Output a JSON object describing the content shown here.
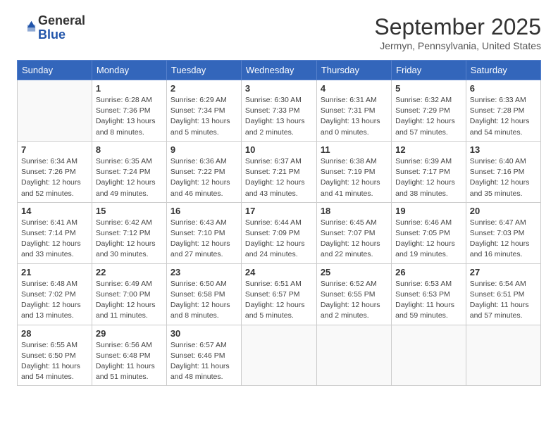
{
  "logo": {
    "general": "General",
    "blue": "Blue"
  },
  "header": {
    "month": "September 2025",
    "location": "Jermyn, Pennsylvania, United States"
  },
  "weekdays": [
    "Sunday",
    "Monday",
    "Tuesday",
    "Wednesday",
    "Thursday",
    "Friday",
    "Saturday"
  ],
  "weeks": [
    [
      {
        "day": "",
        "info": ""
      },
      {
        "day": "1",
        "info": "Sunrise: 6:28 AM\nSunset: 7:36 PM\nDaylight: 13 hours\nand 8 minutes."
      },
      {
        "day": "2",
        "info": "Sunrise: 6:29 AM\nSunset: 7:34 PM\nDaylight: 13 hours\nand 5 minutes."
      },
      {
        "day": "3",
        "info": "Sunrise: 6:30 AM\nSunset: 7:33 PM\nDaylight: 13 hours\nand 2 minutes."
      },
      {
        "day": "4",
        "info": "Sunrise: 6:31 AM\nSunset: 7:31 PM\nDaylight: 13 hours\nand 0 minutes."
      },
      {
        "day": "5",
        "info": "Sunrise: 6:32 AM\nSunset: 7:29 PM\nDaylight: 12 hours\nand 57 minutes."
      },
      {
        "day": "6",
        "info": "Sunrise: 6:33 AM\nSunset: 7:28 PM\nDaylight: 12 hours\nand 54 minutes."
      }
    ],
    [
      {
        "day": "7",
        "info": "Sunrise: 6:34 AM\nSunset: 7:26 PM\nDaylight: 12 hours\nand 52 minutes."
      },
      {
        "day": "8",
        "info": "Sunrise: 6:35 AM\nSunset: 7:24 PM\nDaylight: 12 hours\nand 49 minutes."
      },
      {
        "day": "9",
        "info": "Sunrise: 6:36 AM\nSunset: 7:22 PM\nDaylight: 12 hours\nand 46 minutes."
      },
      {
        "day": "10",
        "info": "Sunrise: 6:37 AM\nSunset: 7:21 PM\nDaylight: 12 hours\nand 43 minutes."
      },
      {
        "day": "11",
        "info": "Sunrise: 6:38 AM\nSunset: 7:19 PM\nDaylight: 12 hours\nand 41 minutes."
      },
      {
        "day": "12",
        "info": "Sunrise: 6:39 AM\nSunset: 7:17 PM\nDaylight: 12 hours\nand 38 minutes."
      },
      {
        "day": "13",
        "info": "Sunrise: 6:40 AM\nSunset: 7:16 PM\nDaylight: 12 hours\nand 35 minutes."
      }
    ],
    [
      {
        "day": "14",
        "info": "Sunrise: 6:41 AM\nSunset: 7:14 PM\nDaylight: 12 hours\nand 33 minutes."
      },
      {
        "day": "15",
        "info": "Sunrise: 6:42 AM\nSunset: 7:12 PM\nDaylight: 12 hours\nand 30 minutes."
      },
      {
        "day": "16",
        "info": "Sunrise: 6:43 AM\nSunset: 7:10 PM\nDaylight: 12 hours\nand 27 minutes."
      },
      {
        "day": "17",
        "info": "Sunrise: 6:44 AM\nSunset: 7:09 PM\nDaylight: 12 hours\nand 24 minutes."
      },
      {
        "day": "18",
        "info": "Sunrise: 6:45 AM\nSunset: 7:07 PM\nDaylight: 12 hours\nand 22 minutes."
      },
      {
        "day": "19",
        "info": "Sunrise: 6:46 AM\nSunset: 7:05 PM\nDaylight: 12 hours\nand 19 minutes."
      },
      {
        "day": "20",
        "info": "Sunrise: 6:47 AM\nSunset: 7:03 PM\nDaylight: 12 hours\nand 16 minutes."
      }
    ],
    [
      {
        "day": "21",
        "info": "Sunrise: 6:48 AM\nSunset: 7:02 PM\nDaylight: 12 hours\nand 13 minutes."
      },
      {
        "day": "22",
        "info": "Sunrise: 6:49 AM\nSunset: 7:00 PM\nDaylight: 12 hours\nand 11 minutes."
      },
      {
        "day": "23",
        "info": "Sunrise: 6:50 AM\nSunset: 6:58 PM\nDaylight: 12 hours\nand 8 minutes."
      },
      {
        "day": "24",
        "info": "Sunrise: 6:51 AM\nSunset: 6:57 PM\nDaylight: 12 hours\nand 5 minutes."
      },
      {
        "day": "25",
        "info": "Sunrise: 6:52 AM\nSunset: 6:55 PM\nDaylight: 12 hours\nand 2 minutes."
      },
      {
        "day": "26",
        "info": "Sunrise: 6:53 AM\nSunset: 6:53 PM\nDaylight: 11 hours\nand 59 minutes."
      },
      {
        "day": "27",
        "info": "Sunrise: 6:54 AM\nSunset: 6:51 PM\nDaylight: 11 hours\nand 57 minutes."
      }
    ],
    [
      {
        "day": "28",
        "info": "Sunrise: 6:55 AM\nSunset: 6:50 PM\nDaylight: 11 hours\nand 54 minutes."
      },
      {
        "day": "29",
        "info": "Sunrise: 6:56 AM\nSunset: 6:48 PM\nDaylight: 11 hours\nand 51 minutes."
      },
      {
        "day": "30",
        "info": "Sunrise: 6:57 AM\nSunset: 6:46 PM\nDaylight: 11 hours\nand 48 minutes."
      },
      {
        "day": "",
        "info": ""
      },
      {
        "day": "",
        "info": ""
      },
      {
        "day": "",
        "info": ""
      },
      {
        "day": "",
        "info": ""
      }
    ]
  ]
}
